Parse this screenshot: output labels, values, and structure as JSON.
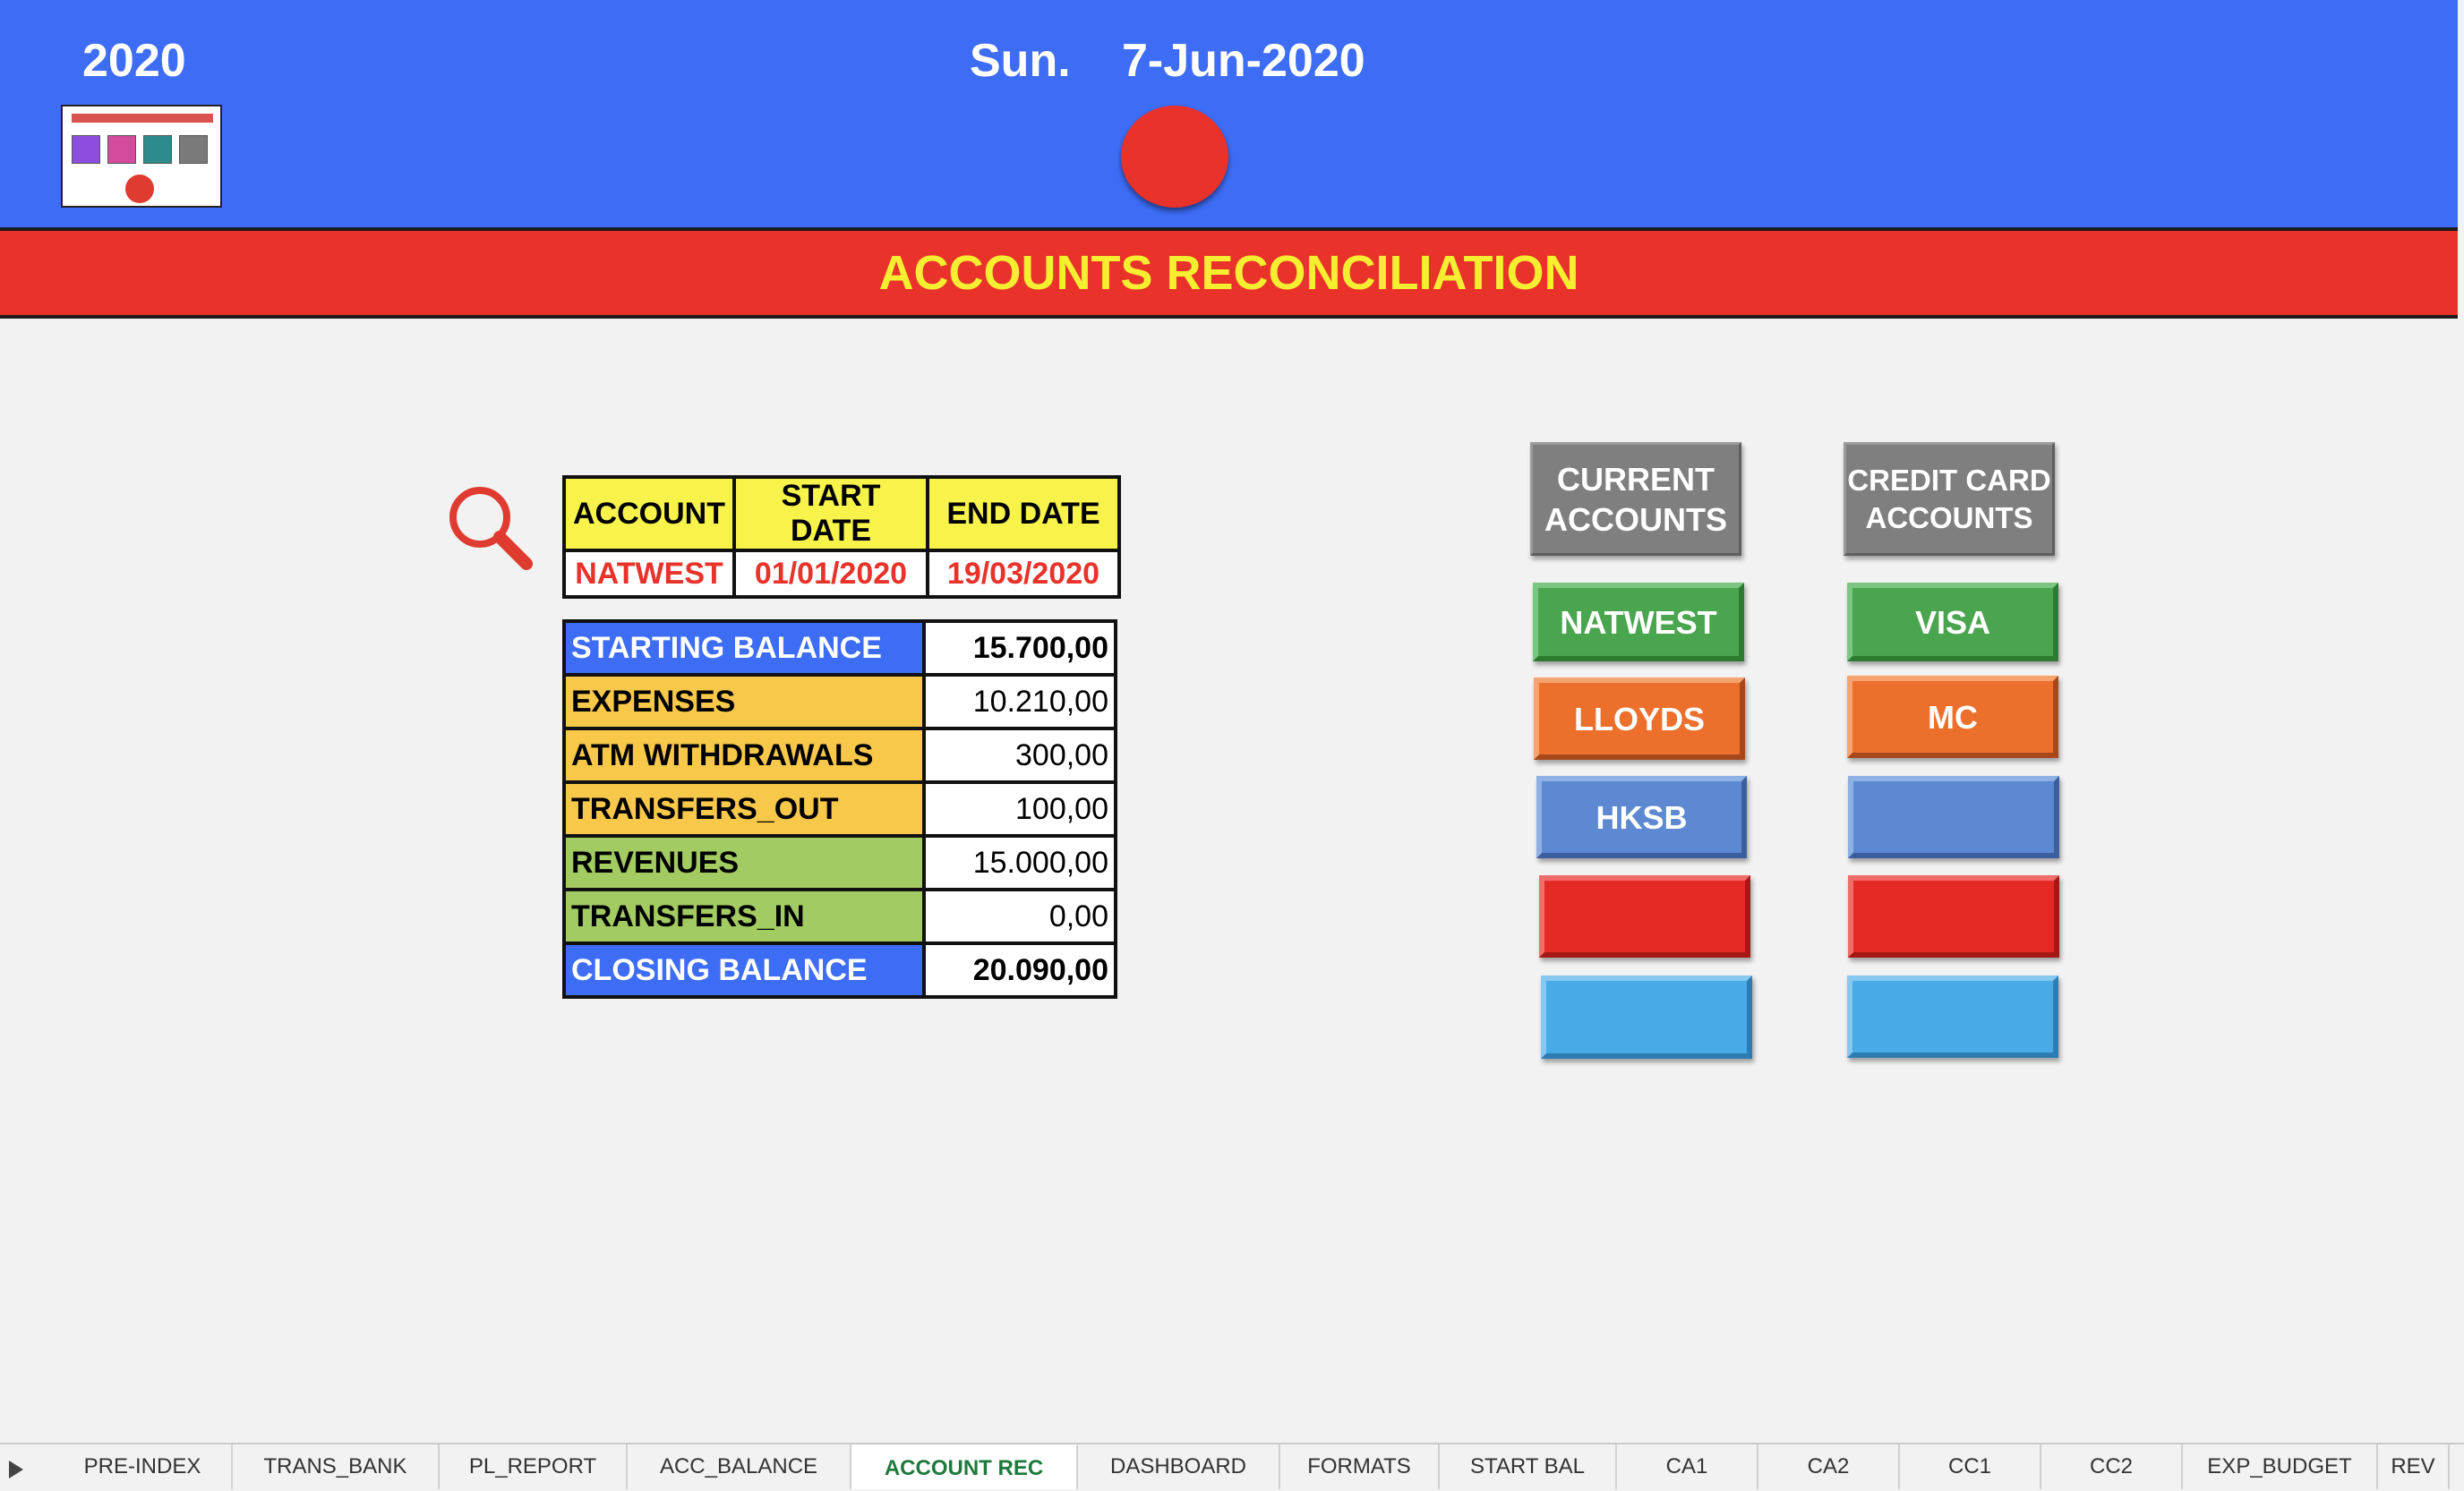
{
  "header": {
    "year": "2020",
    "day_of_week": "Sun.",
    "date": "7-Jun-2020",
    "menu_thumb_colors": [
      "#8d4ee0",
      "#d44a9c",
      "#2e8b8b",
      "#7a7a7a"
    ],
    "status_color": "#e8322a"
  },
  "banner": {
    "title": "ACCOUNTS RECONCILIATION"
  },
  "account_filter": {
    "headers": [
      "ACCOUNT",
      "START DATE",
      "END DATE"
    ],
    "values": [
      "NATWEST",
      "01/01/2020",
      "19/03/2020"
    ]
  },
  "balances": [
    {
      "label": "STARTING BALANCE",
      "value": "15.700,00",
      "color": "#3d6cf5",
      "text": "#ffffff",
      "bold": true
    },
    {
      "label": "EXPENSES",
      "value": "10.210,00",
      "color": "#f7c84a",
      "text": "#000000",
      "bold": false
    },
    {
      "label": "ATM WITHDRAWALS",
      "value": "300,00",
      "color": "#f7c84a",
      "text": "#000000",
      "bold": false
    },
    {
      "label": "TRANSFERS_OUT",
      "value": "100,00",
      "color": "#f7c84a",
      "text": "#000000",
      "bold": false
    },
    {
      "label": "REVENUES",
      "value": "15.000,00",
      "color": "#a2cc62",
      "text": "#000000",
      "bold": false
    },
    {
      "label": "TRANSFERS_IN",
      "value": "0,00",
      "color": "#a2cc62",
      "text": "#000000",
      "bold": false
    },
    {
      "label": "CLOSING BALANCE",
      "value": "20.090,00",
      "color": "#3d6cf5",
      "text": "#ffffff",
      "bold": true
    }
  ],
  "account_buttons": {
    "current_header": "CURRENT ACCOUNTS",
    "credit_header": "CREDIT CARD ACCOUNTS",
    "current": [
      "NATWEST",
      "LLOYDS",
      "HKSB",
      "",
      ""
    ],
    "credit": [
      "VISA",
      "MC",
      "",
      "",
      ""
    ]
  },
  "sheet_tabs": [
    "PRE-INDEX",
    "TRANS_BANK",
    "PL_REPORT",
    "ACC_BALANCE",
    "ACCOUNT REC",
    "DASHBOARD",
    "FORMATS",
    "START BAL",
    "CA1",
    "CA2",
    "CC1",
    "CC2",
    "EXP_BUDGET",
    "REV"
  ],
  "active_tab": "ACCOUNT REC"
}
